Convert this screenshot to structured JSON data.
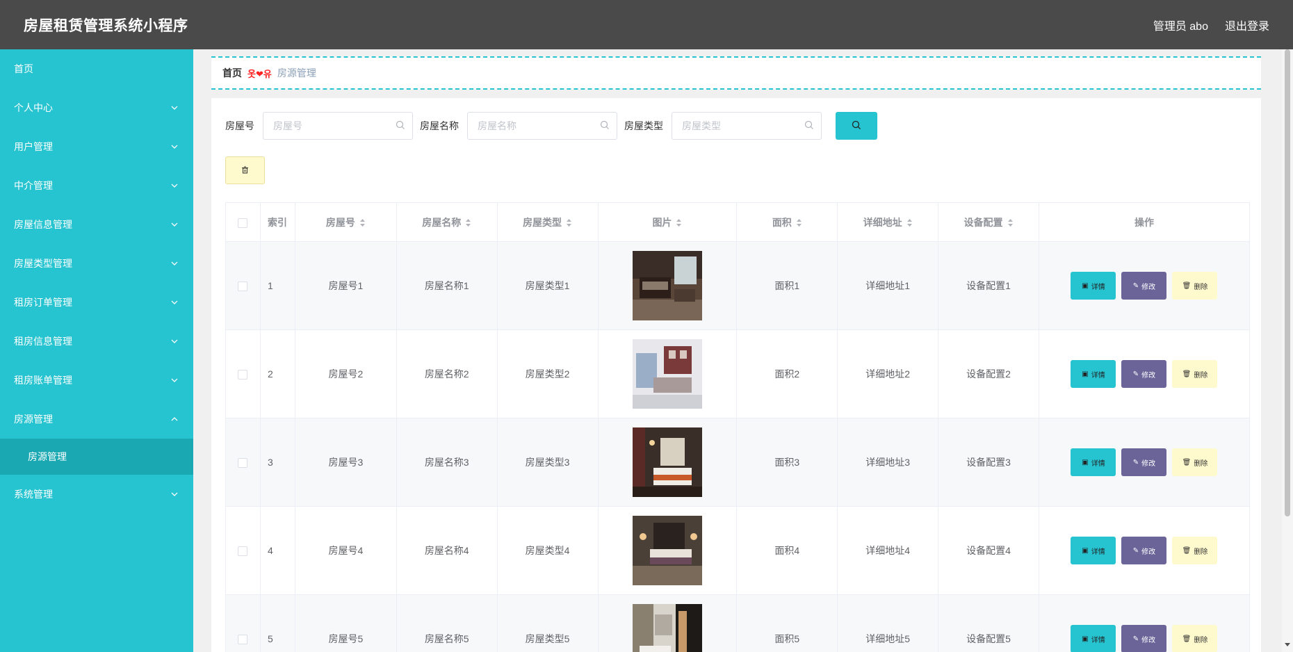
{
  "header": {
    "app_title": "房屋租赁管理系统小程序",
    "user_label": "管理员 abo",
    "logout_label": "退出登录"
  },
  "sidebar": {
    "items": [
      {
        "label": "首页",
        "has_chevron": false
      },
      {
        "label": "个人中心",
        "has_chevron": true
      },
      {
        "label": "用户管理",
        "has_chevron": true
      },
      {
        "label": "中介管理",
        "has_chevron": true
      },
      {
        "label": "房屋信息管理",
        "has_chevron": true
      },
      {
        "label": "房屋类型管理",
        "has_chevron": true
      },
      {
        "label": "租房订单管理",
        "has_chevron": true
      },
      {
        "label": "租房信息管理",
        "has_chevron": true
      },
      {
        "label": "租房账单管理",
        "has_chevron": true
      },
      {
        "label": "房源管理",
        "has_chevron": true,
        "expanded": true
      },
      {
        "label": "系统管理",
        "has_chevron": true
      }
    ],
    "sub_item": "房源管理"
  },
  "breadcrumb": {
    "home": "首页",
    "separator": "옷❤유",
    "current": "房源管理"
  },
  "search": {
    "field1_label": "房屋号",
    "field1_placeholder": "房屋号",
    "field2_label": "房屋名称",
    "field2_placeholder": "房屋名称",
    "field3_label": "房屋类型",
    "field3_placeholder": "房屋类型"
  },
  "table": {
    "headers": [
      "索引",
      "房屋号",
      "房屋名称",
      "房屋类型",
      "图片",
      "面积",
      "详细地址",
      "设备配置",
      "操作"
    ],
    "rows": [
      {
        "index": "1",
        "house_no": "房屋号1",
        "house_name": "房屋名称1",
        "house_type": "房屋类型1",
        "area": "面积1",
        "address": "详细地址1",
        "equipment": "设备配置1"
      },
      {
        "index": "2",
        "house_no": "房屋号2",
        "house_name": "房屋名称2",
        "house_type": "房屋类型2",
        "area": "面积2",
        "address": "详细地址2",
        "equipment": "设备配置2"
      },
      {
        "index": "3",
        "house_no": "房屋号3",
        "house_name": "房屋名称3",
        "house_type": "房屋类型3",
        "area": "面积3",
        "address": "详细地址3",
        "equipment": "设备配置3"
      },
      {
        "index": "4",
        "house_no": "房屋号4",
        "house_name": "房屋名称4",
        "house_type": "房屋类型4",
        "area": "面积4",
        "address": "详细地址4",
        "equipment": "设备配置4"
      },
      {
        "index": "5",
        "house_no": "房屋号5",
        "house_name": "房屋名称5",
        "house_type": "房屋类型5",
        "area": "面积5",
        "address": "详细地址5",
        "equipment": "设备配置5"
      }
    ],
    "ops": {
      "detail": "详情",
      "edit": "修改",
      "delete": "删除"
    }
  },
  "colors": {
    "topbar": "#4a4a4a",
    "sidebar": "#26c3d0",
    "sidebar_active": "#1aa8b3",
    "edit_button": "#6a6499",
    "delete_button": "#fffacd"
  }
}
